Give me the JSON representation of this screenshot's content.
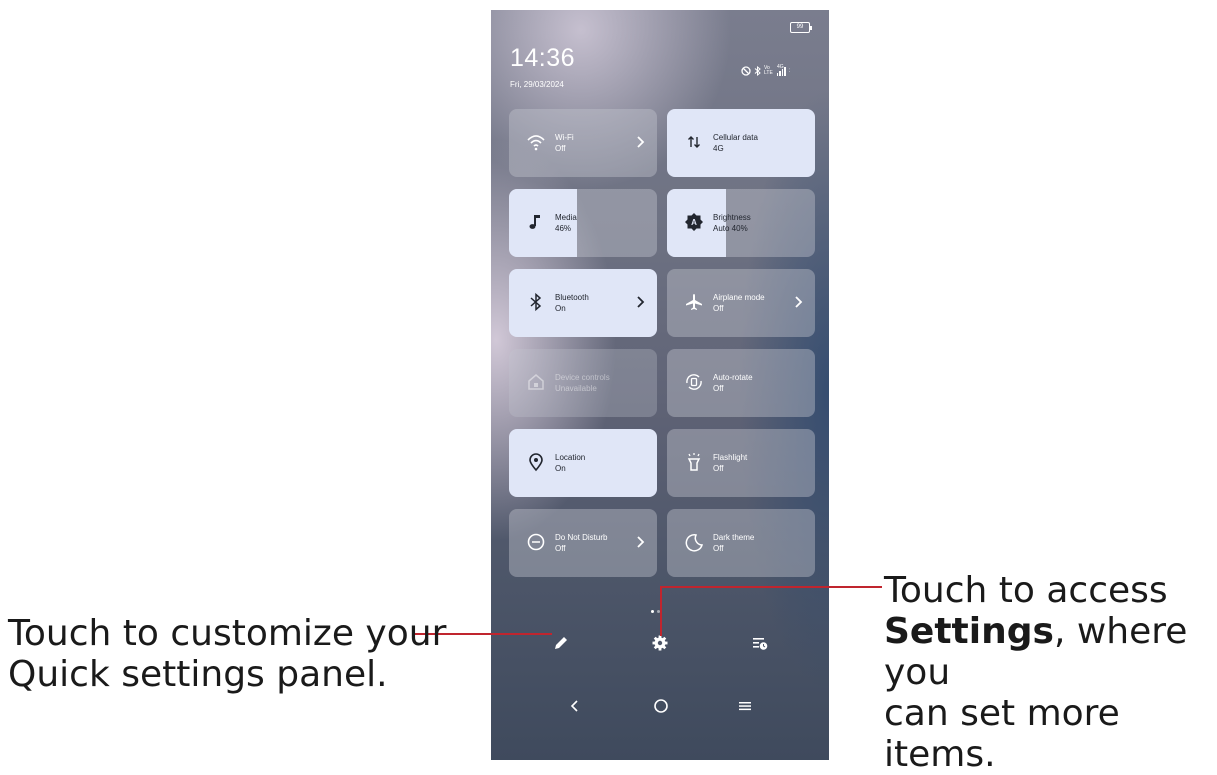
{
  "status_bar": {
    "time": "14:36",
    "date": "Fri, 29/03/2024",
    "battery": "99",
    "network_top": "4G",
    "network_volte": "Vo LTE"
  },
  "tiles": [
    {
      "name": "Wi-Fi",
      "state": "Off",
      "style": "off",
      "chevron": true,
      "icon": "wifi-icon"
    },
    {
      "name": "Cellular data",
      "state": "4G",
      "style": "on",
      "chevron": false,
      "icon": "data-arrows-icon"
    },
    {
      "name": "Media",
      "state": "46%",
      "style": "split",
      "level": 0.46,
      "icon": "music-note-icon"
    },
    {
      "name": "Brightness",
      "state": "Auto 40%",
      "style": "split",
      "level": 0.4,
      "icon": "brightness-auto-icon"
    },
    {
      "name": "Bluetooth",
      "state": "On",
      "style": "on",
      "chevron": true,
      "icon": "bluetooth-icon"
    },
    {
      "name": "Airplane mode",
      "state": "Off",
      "style": "off",
      "chevron": true,
      "icon": "airplane-icon"
    },
    {
      "name": "Device controls",
      "state": "Unavailable",
      "style": "unavail",
      "chevron": false,
      "icon": "home-icon"
    },
    {
      "name": "Auto-rotate",
      "state": "Off",
      "style": "off",
      "chevron": false,
      "icon": "auto-rotate-icon"
    },
    {
      "name": "Location",
      "state": "On",
      "style": "on",
      "chevron": false,
      "icon": "location-pin-icon"
    },
    {
      "name": "Flashlight",
      "state": "Off",
      "style": "off",
      "chevron": false,
      "icon": "flashlight-icon"
    },
    {
      "name": "Do Not Disturb",
      "state": "Off",
      "style": "off",
      "chevron": true,
      "icon": "do-not-disturb-icon"
    },
    {
      "name": "Dark theme",
      "state": "Off",
      "style": "off",
      "chevron": false,
      "icon": "moon-icon"
    }
  ],
  "bottom_actions": [
    "pencil-icon",
    "gear-icon",
    "timer-list-icon"
  ],
  "nav_bar": [
    "back-icon",
    "home-circle-icon",
    "menu-lines-icon"
  ],
  "annotations": {
    "left_line1": "Touch to customize your",
    "left_line2": "Quick settings panel.",
    "right_line1": "Touch to access",
    "right_bold": "Settings",
    "right_line2_rest": ", where you",
    "right_line3": "can set more items."
  },
  "colors": {
    "leader_line": "#c0252e",
    "tile_on": "#e0e6f7"
  }
}
